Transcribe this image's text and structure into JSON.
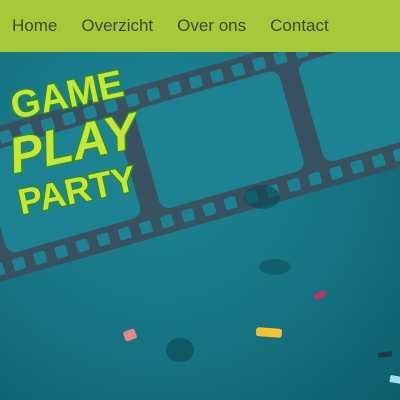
{
  "nav": {
    "items": [
      {
        "label": "Home"
      },
      {
        "label": "Overzicht"
      },
      {
        "label": "Over ons"
      },
      {
        "label": "Contact"
      }
    ]
  },
  "logo": {
    "line1": "GAME",
    "line2": "PLAY",
    "line3": "PARTY"
  },
  "colors": {
    "nav_bg": "#a6c93a",
    "nav_text": "#3b4a3c",
    "hero_bg": "#1a7f8f",
    "film_strip": "#3a4f5e",
    "logo_fill": "#c5e63a",
    "logo_stroke": "#2f8a2a"
  },
  "icons": [
    "film-strip",
    "confetti"
  ]
}
